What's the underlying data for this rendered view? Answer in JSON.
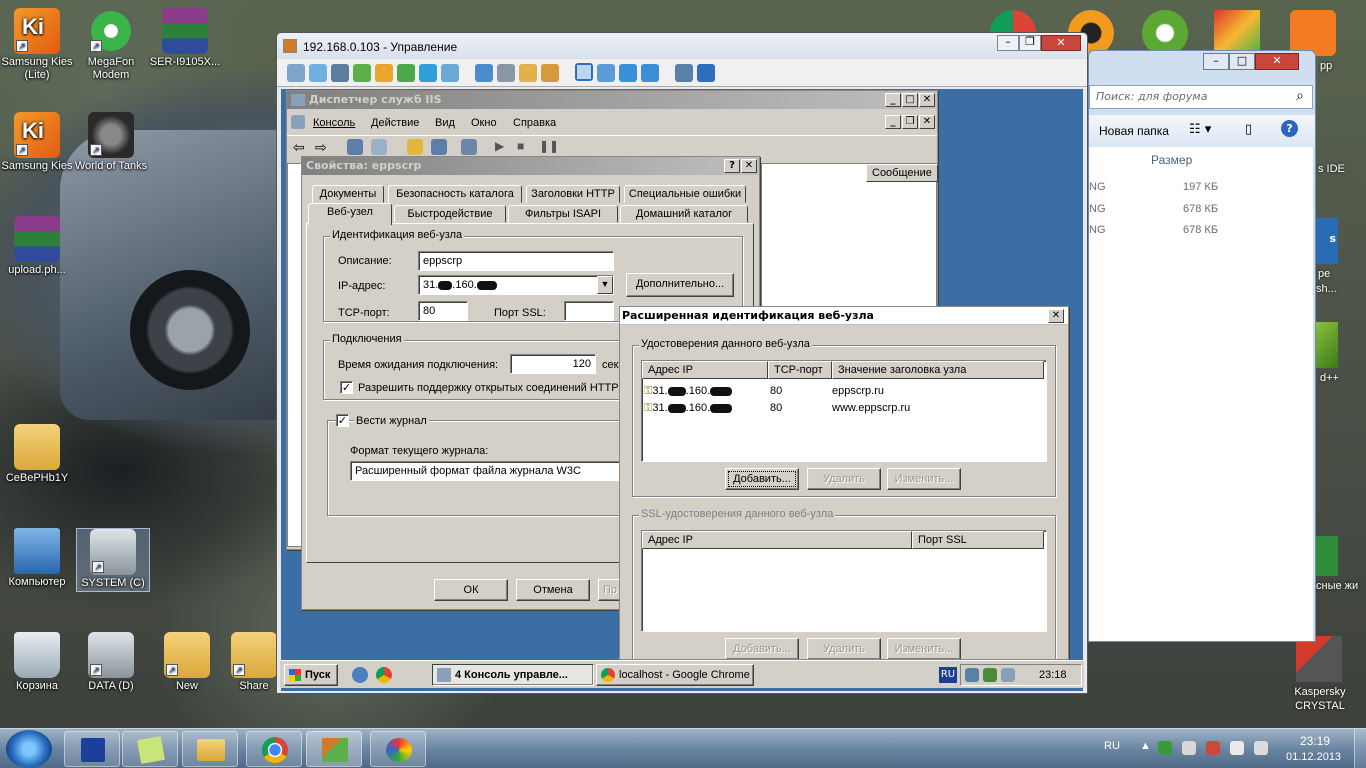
{
  "desktop": {
    "icons_left": [
      {
        "name": "samsung-kies-lite-icon",
        "label": "Samsung Kies (Lite)"
      },
      {
        "name": "megafon-modem-icon",
        "label": "MegaFon Modem"
      },
      {
        "name": "archive-icon",
        "label": "SER-I9105X..."
      },
      {
        "name": "samsung-kies-icon",
        "label": "Samsung Kies"
      },
      {
        "name": "world-of-tanks-icon",
        "label": "World of Tanks"
      },
      {
        "name": "archive-upload-icon",
        "label": "upload.ph..."
      },
      {
        "name": "user-folder-icon",
        "label": "CeBePHb1Y"
      },
      {
        "name": "computer-icon",
        "label": "Компьютер"
      },
      {
        "name": "drive-icon",
        "label": "SYSTEM (C)"
      },
      {
        "name": "recycle-bin-icon",
        "label": "Корзина"
      },
      {
        "name": "drive-data-icon",
        "label": "DATA (D)"
      },
      {
        "name": "folder-new-icon",
        "label": "New"
      },
      {
        "name": "folder-share-icon",
        "label": "Share"
      }
    ],
    "right_labels": [
      "pp",
      "s IDE",
      "s",
      "pe",
      "sh...",
      "d++",
      "сные жи",
      "Kaspersky CRYSTAL"
    ]
  },
  "explorer": {
    "search_placeholder": "Поиск: для форума",
    "new_folder": "Новая папка",
    "col_size": "Размер",
    "rows": [
      {
        "name": "NG",
        "size": "197 КБ"
      },
      {
        "name": "NG",
        "size": "678 КБ"
      },
      {
        "name": "NG",
        "size": "678 КБ"
      }
    ]
  },
  "rdp": {
    "title": "192.168.0.103 - Управление"
  },
  "iis": {
    "title": "Диспетчер служб IIS",
    "menu": [
      "Консоль",
      "Действие",
      "Вид",
      "Окно",
      "Справка"
    ],
    "col_message": "Сообщение с"
  },
  "props": {
    "title": "Свойства: eppscrp",
    "tabs_row1": [
      "Документы",
      "Безопасность каталога",
      "Заголовки HTTP",
      "Специальные ошибки"
    ],
    "tabs_row2": [
      "Веб-узел",
      "Быстродействие",
      "Фильтры ISAPI",
      "Домашний каталог"
    ],
    "group_id": "Идентификация веб-узла",
    "desc_label": "Описание:",
    "desc_value": "eppscrp",
    "ip_label": "IP-адрес:",
    "ip_value_a": "31.",
    "ip_value_b": ".160.",
    "more_button": "Дополнительно...",
    "tcp_label": "TCP-порт:",
    "tcp_value": "80",
    "ssl_label": "Порт SSL:",
    "group_conn": "Подключения",
    "timeout_label": "Время ожидания подключения:",
    "timeout_value": "120",
    "timeout_unit": "секу",
    "keepalive_label": "Разрешить поддержку открытых соединений HTTP",
    "log_label": "Вести журнал",
    "log_format_label": "Формат текущего журнала:",
    "log_format_value": "Расширенный формат файла журнала W3C",
    "ok": "ОК",
    "cancel": "Отмена",
    "apply": "Пр"
  },
  "adv": {
    "title": "Расширенная идентификация веб-узла",
    "group1": "Удостоверения данного веб-узла",
    "col_ip": "Адрес IP",
    "col_tcp": "TCP-порт",
    "col_host": "Значение заголовка узла",
    "rows": [
      {
        "ip_a": "31.",
        "ip_b": ".160.",
        "port": "80",
        "host": "eppscrp.ru"
      },
      {
        "ip_a": "31.",
        "ip_b": ".160.",
        "port": "80",
        "host": "www.eppscrp.ru"
      }
    ],
    "add": "Добавить...",
    "remove": "Удалить",
    "edit": "Изменить...",
    "group2": "SSL-удостоверения данного веб-узла",
    "col_ssl": "Порт SSL"
  },
  "remote_taskbar": {
    "start": "Пуск",
    "task1": "4 Консоль управле...",
    "task2": "localhost - Google Chrome",
    "lang": "RU",
    "time": "23:18"
  },
  "taskbar": {
    "lang": "RU",
    "time": "23:19",
    "date": "01.12.2013"
  }
}
